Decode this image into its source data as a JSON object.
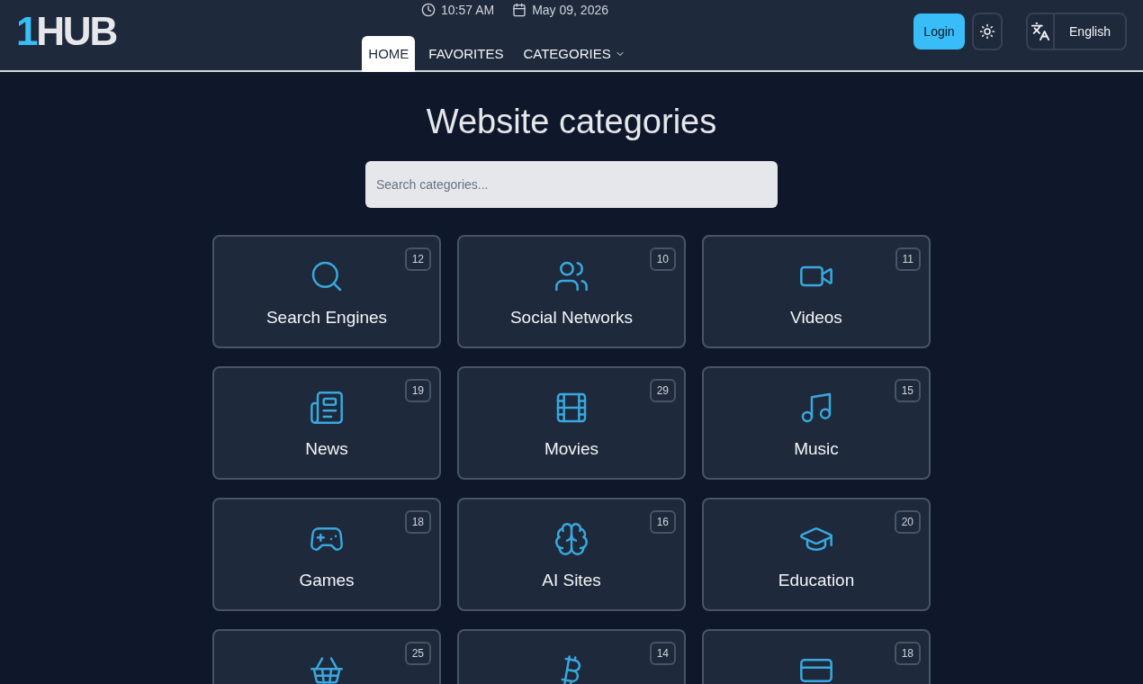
{
  "logo": {
    "accent": "1",
    "text": "HUB"
  },
  "clock": {
    "time": "10:57 AM",
    "date": "May 09, 2026"
  },
  "nav": [
    {
      "label": "HOME",
      "selected": true,
      "dropdown": false
    },
    {
      "label": "FAVORITES",
      "selected": false,
      "dropdown": false
    },
    {
      "label": "CATEGORIES",
      "selected": false,
      "dropdown": true
    }
  ],
  "login": "Login",
  "language": "English",
  "title": "Website categories",
  "search": {
    "placeholder": "Search categories..."
  },
  "categories": [
    {
      "name": "Search Engines",
      "count": "12"
    },
    {
      "name": "Social Networks",
      "count": "10"
    },
    {
      "name": "Videos",
      "count": "11"
    },
    {
      "name": "News",
      "count": "19"
    },
    {
      "name": "Movies",
      "count": "29"
    },
    {
      "name": "Music",
      "count": "15"
    },
    {
      "name": "Games",
      "count": "18"
    },
    {
      "name": "AI Sites",
      "count": "16"
    },
    {
      "name": "Education",
      "count": "20"
    },
    {
      "count": "25"
    },
    {
      "count": "14"
    },
    {
      "count": "18"
    }
  ]
}
